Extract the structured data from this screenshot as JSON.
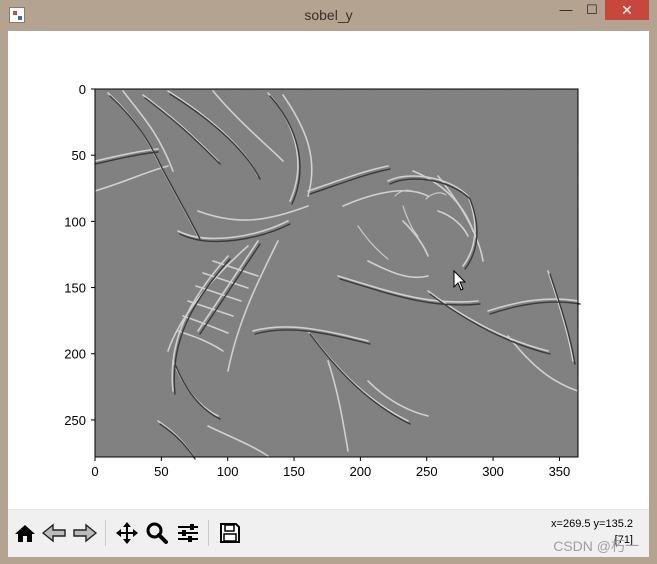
{
  "window": {
    "title": "sobel_y",
    "minimize_label": "—",
    "maximize_label": "☐",
    "close_label": "✕"
  },
  "plot": {
    "xticks": [
      "0",
      "50",
      "100",
      "150",
      "200",
      "250",
      "300",
      "350"
    ],
    "yticks": [
      "0",
      "50",
      "100",
      "150",
      "200",
      "250"
    ],
    "xlim": [
      0,
      364
    ],
    "ylim": [
      278,
      0
    ]
  },
  "toolbar": {
    "buttons": [
      {
        "name": "home-button",
        "icon": "home-icon"
      },
      {
        "name": "back-button",
        "icon": "arrow-left-icon"
      },
      {
        "name": "forward-button",
        "icon": "arrow-right-icon"
      },
      {
        "name": "pan-button",
        "icon": "move-icon"
      },
      {
        "name": "zoom-button",
        "icon": "magnifier-icon"
      },
      {
        "name": "configure-subplots-button",
        "icon": "sliders-icon"
      },
      {
        "name": "save-button",
        "icon": "floppy-disk-icon"
      }
    ],
    "coords_line1": "x=269.5 y=135.2",
    "coords_line2": "[71]"
  },
  "watermark": "CSDN @朽一"
}
